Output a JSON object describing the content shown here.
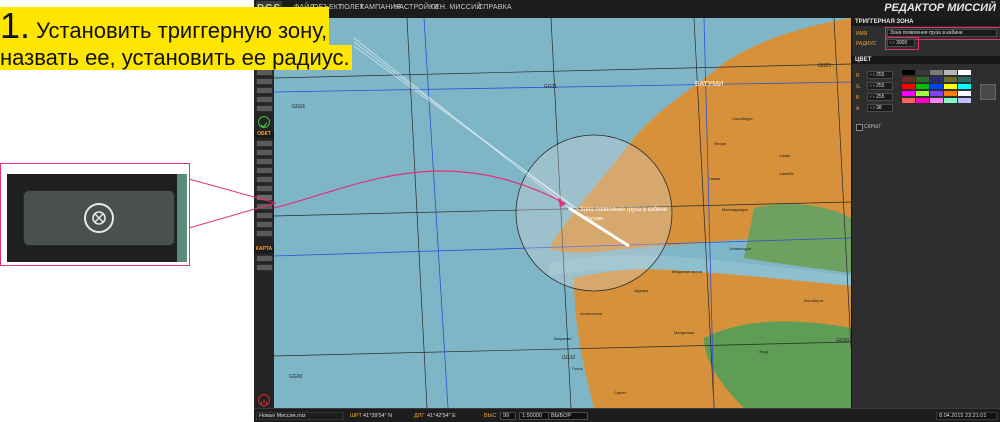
{
  "instruction": {
    "number": "1.",
    "line1": "Установить триггерную зону,",
    "line2": "назвать ее, установить ее радиус."
  },
  "menu": {
    "logo": "DCS",
    "items": [
      "ФАЙЛ",
      "ОБЪЕКТ",
      "ПОЛЕТ",
      "КАМПАНИЯ",
      "НАСТРОЙКИ",
      "ГЕН. МИССИЙ",
      "СПРАВКА"
    ],
    "title": "РЕДАКТОР МИССИЙ"
  },
  "toolbar": {
    "section_object": "ОБКТ",
    "section_map": "КАРТА"
  },
  "map": {
    "city_label": "БАТУМИ",
    "grid_labels": [
      "GG11",
      "GG21",
      "GG01",
      "GG10",
      "GG00",
      "GG20"
    ],
    "zone_label": "Зона появления груза в кабине",
    "airfield_label": "Батуми",
    "place_names": [
      "Салибаури",
      "Флорв",
      "Сакре",
      "Чаква",
      "Самеба",
      "Махинджаури",
      "Хелвачаури",
      "Меджинистрали",
      "Ахалсопели",
      "Зеда",
      "Гонио",
      "Квариати",
      "Сарпи",
      "Мандатики",
      "Аджара",
      "Кахоберти"
    ]
  },
  "panel": {
    "section_title": "ТРИГГЕРНАЯ ЗОНА",
    "name_label": "ИМЯ",
    "name_value": "Зона появления груза в кабине",
    "radius_label": "РАДИУС",
    "radius_value": "3000",
    "color_header": "ЦВЕТ",
    "color_channels": [
      {
        "label": "R",
        "value": "255"
      },
      {
        "label": "G",
        "value": "255"
      },
      {
        "label": "B",
        "value": "255"
      },
      {
        "label": "A",
        "value": "38"
      }
    ],
    "palette": [
      "#000000",
      "#3a3a3a",
      "#7a7a7a",
      "#b5b5b5",
      "#ffffff",
      "#6b2b2b",
      "#2b6b2b",
      "#2b2b6b",
      "#6b6b2b",
      "#2b6b6b",
      "#ff0000",
      "#00c000",
      "#0040ff",
      "#ffff00",
      "#00ffff",
      "#ff00ff",
      "#a0ff40",
      "#8040ff",
      "#ff8000",
      "#ffffff",
      "#ff6060",
      "#ff00c0",
      "#ff80ff",
      "#80ffc0",
      "#c0c0ff"
    ],
    "hidden_label": "СКРЫТ"
  },
  "status": {
    "file_name": "Новая Миссия.miz",
    "lat_label": "ШРТ",
    "lat_value": "41°39'54\" N",
    "lon_label": "ДЛГ",
    "lon_value": "41°42'54\" E",
    "alt_label": "ВЫС",
    "alt_value": "99",
    "scale_value": "1:50000",
    "mode_value": "ВЫБОР",
    "datetime": "8.04.2015 23:21:01"
  }
}
